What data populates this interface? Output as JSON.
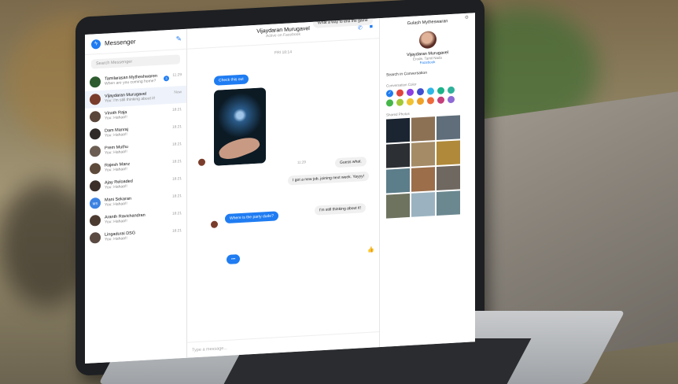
{
  "messenger": {
    "title": "Messenger",
    "search_placeholder": "Search Messenger",
    "conversations": [
      {
        "name": "Tamilarasan Mytheshwaren",
        "preview": "When are you coming home?",
        "time": "11:29",
        "badge": "3",
        "color": "#2d5b2e"
      },
      {
        "name": "Vijaydaran Murugavel",
        "preview": "You: I'm still thinking about it!",
        "time": "Now",
        "color": "#7a3d2b"
      },
      {
        "name": "Vinoth Raja",
        "preview": "You: Hahaa!!",
        "time": "18:21",
        "color": "#5b463b"
      },
      {
        "name": "Dam Manraj",
        "preview": "You: Hahaa!!",
        "time": "18:21",
        "color": "#2f2a28"
      },
      {
        "name": "Prem Muthu",
        "preview": "You: Hahaa!!",
        "time": "18:21",
        "color": "#6b5d52"
      },
      {
        "name": "Rajesh Manz",
        "preview": "You: Hahaa!!",
        "time": "18:21",
        "color": "#5e4a3a"
      },
      {
        "name": "Ajay Reloaded",
        "preview": "You: Hahaa!!",
        "time": "18:21",
        "color": "#3c2f2a"
      },
      {
        "name": "Mani Sekaran",
        "preview": "You: Hahaa!!",
        "time": "18:21",
        "color": "#3c82e2",
        "initials": "MS"
      },
      {
        "name": "Aranth Ravichandran",
        "preview": "You: Hahaa!!",
        "time": "18:21",
        "color": "#4b3a30"
      },
      {
        "name": "Lingadurai DSG",
        "preview": "You: Hahaa!!",
        "time": "18:21",
        "color": "#5a4a42"
      }
    ],
    "chat": {
      "contact": "Vijaydaran Murugavel",
      "status": "Active on Facebook",
      "top_message": "What a way to end the game",
      "day": "FRI 18:14",
      "check_out": "Check this out",
      "photo_time": "11:29",
      "guess_what": "Guess what.",
      "new_job": "I got a new job, joining next week. Yayyy!",
      "party": "Where is the party dude?",
      "thinking": "I'm still thinking about it!",
      "typing": "•••",
      "compose_placeholder": "Type a message..."
    },
    "info": {
      "user": "Gulash Mytheswaran",
      "name": "Vijaydaran Murugavel",
      "location": "Erode, Tamil Nadu",
      "facebook": "Facebook",
      "search_conv": "Search in Conversation",
      "colors_label": "Conversation Color",
      "photos_label": "Shared Photos",
      "colors": [
        "#1f7cf2",
        "#e0443e",
        "#8b3fe2",
        "#3f4fd0",
        "#2fb6e8",
        "#1bb38a",
        "#2fb19a",
        "#46b649",
        "#a3c837",
        "#f2c230",
        "#f0a226",
        "#ee6a3a",
        "#c53f7b",
        "#8d6ad5"
      ]
    }
  }
}
